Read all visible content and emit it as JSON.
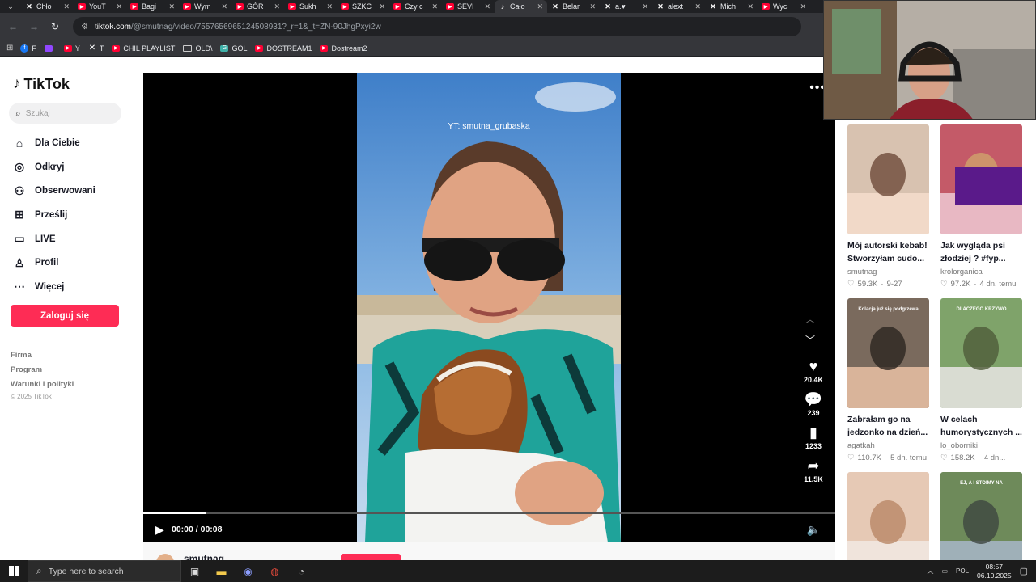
{
  "browser": {
    "tabs": [
      {
        "title": "Chło",
        "icon": "x-icon",
        "kind": "x",
        "active": false
      },
      {
        "title": "YouT",
        "icon": "youtube-icon",
        "kind": "yt",
        "active": false
      },
      {
        "title": "Bagi",
        "icon": "youtube-icon",
        "kind": "yt",
        "active": false
      },
      {
        "title": "Wym",
        "icon": "youtube-icon",
        "kind": "yt",
        "active": false
      },
      {
        "title": "GÓR",
        "icon": "youtube-icon",
        "kind": "yt",
        "active": false
      },
      {
        "title": "Sukh",
        "icon": "youtube-icon",
        "kind": "yt",
        "active": false
      },
      {
        "title": "SZKC",
        "icon": "youtube-icon",
        "kind": "yt",
        "active": false
      },
      {
        "title": "Czy c",
        "icon": "youtube-icon",
        "kind": "yt",
        "active": false
      },
      {
        "title": "SEVI",
        "icon": "youtube-icon",
        "kind": "yt",
        "active": false
      },
      {
        "title": "Cało",
        "icon": "tiktok-icon",
        "kind": "tt",
        "active": true
      },
      {
        "title": "Belar",
        "icon": "x-icon",
        "kind": "x",
        "active": false
      },
      {
        "title": "a.♥",
        "icon": "x-icon",
        "kind": "x",
        "active": false
      },
      {
        "title": "alext",
        "icon": "x-icon",
        "kind": "x",
        "active": false
      },
      {
        "title": "Mich",
        "icon": "x-icon",
        "kind": "x",
        "active": false
      },
      {
        "title": "Wyc",
        "icon": "youtube-icon",
        "kind": "yt",
        "active": false
      }
    ],
    "url_host": "tiktok.com",
    "url_path": "/@smutnag/video/7557656965124508931?_r=1&_t=ZN-90JhgPxyi2w",
    "bookmarks": [
      {
        "label": "F",
        "kind": "fb"
      },
      {
        "label": "",
        "kind": "tw"
      },
      {
        "label": "Y",
        "kind": "yt"
      },
      {
        "label": "T",
        "kind": "xx"
      },
      {
        "label": "CHIL PLAYLIST",
        "kind": "yt"
      },
      {
        "label": "OLD\\",
        "kind": "folder"
      },
      {
        "label": "GOL",
        "kind": "gol"
      },
      {
        "label": "DOSTREAM1",
        "kind": "yt"
      },
      {
        "label": "Dostream2",
        "kind": "yt"
      }
    ]
  },
  "tiktok": {
    "logo_text": "TikTok",
    "search_placeholder": "Szukaj",
    "nav": [
      {
        "label": "Dla Ciebie",
        "icon": "home-icon",
        "glyph": "⌂"
      },
      {
        "label": "Odkryj",
        "icon": "compass-icon",
        "glyph": "◎"
      },
      {
        "label": "Obserwowani",
        "icon": "following-icon",
        "glyph": "⚇"
      },
      {
        "label": "Prześlij",
        "icon": "upload-icon",
        "glyph": "⊞"
      },
      {
        "label": "LIVE",
        "icon": "live-icon",
        "glyph": "▭"
      },
      {
        "label": "Profil",
        "icon": "profile-icon",
        "glyph": "♙"
      },
      {
        "label": "Więcej",
        "icon": "more-icon",
        "glyph": "⋯"
      }
    ],
    "login_label": "Zaloguj się",
    "footer_links": [
      "Firma",
      "Program",
      "Warunki i polityki"
    ],
    "copyright": "© 2025 TikTok"
  },
  "video": {
    "watermark": "YT: smutna_grubaska",
    "time": "00:00 / 00:08",
    "progress_fraction": 0.09,
    "stats": {
      "likes": "20.4K",
      "comments": "239",
      "saves": "1233",
      "shares": "11.5K"
    },
    "author": "smutnag"
  },
  "recommendations": [
    {
      "title": "Mój autorski kebab! Stworzyłam cudo...",
      "author": "smutnag",
      "likes": "59.3K",
      "date": "9-27"
    },
    {
      "title": "Jak wygląda psi złodziej ? #fyp...",
      "author": "krolorganica",
      "likes": "97.2K",
      "date": "4 dn. temu"
    },
    {
      "title": "Zabrałam go na jedzonko na dzień...",
      "author": "agatkah",
      "likes": "110.7K",
      "date": "5 dn. temu",
      "overlay": "Kolacja już się podgrzewa"
    },
    {
      "title": "W celach humorystycznych ...",
      "author": "lo_oborniki",
      "likes": "158.2K",
      "date": "4 dn...",
      "overlay": "DLACZEGO KRZYWO"
    },
    {
      "title": "",
      "author": "",
      "likes": "",
      "date": ""
    },
    {
      "title": "",
      "author": "",
      "likes": "",
      "date": "",
      "overlay": "EJ, A I STOIMY NA"
    }
  ],
  "taskbar": {
    "search_placeholder": "Type here to search",
    "lang": "POL",
    "time": "08:57",
    "date": "06.10.2025"
  },
  "colors": {
    "accent": "#fe2c55",
    "chrome_dark": "#202124",
    "chrome": "#35363a"
  }
}
